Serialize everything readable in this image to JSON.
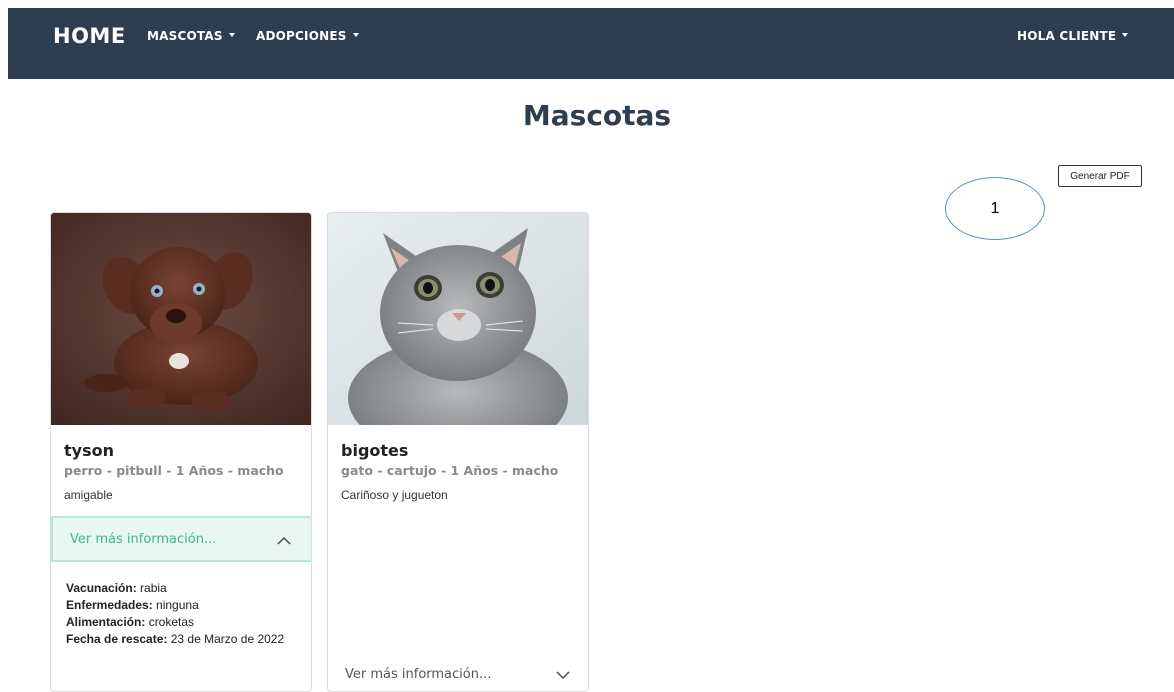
{
  "navbar": {
    "brand": "HOME",
    "menu": [
      {
        "label": "MASCOTAS"
      },
      {
        "label": "ADOPCIONES"
      }
    ],
    "user_menu": "HOLA CLIENTE"
  },
  "page": {
    "title": "Mascotas",
    "pdf_button": "Generar PDF",
    "callout": "1"
  },
  "pets": [
    {
      "name": "tyson",
      "subtitle": "perro - pitbull - 1 Años - macho",
      "description": "amigable",
      "more_label": "Ver más información...",
      "expanded": true,
      "details": [
        {
          "label": "Vacunación:",
          "value": "rabia"
        },
        {
          "label": "Enfermedades:",
          "value": "ninguna"
        },
        {
          "label": "Alimentación:",
          "value": "croketas"
        },
        {
          "label": "Fecha de rescate:",
          "value": "23 de Marzo de 2022"
        }
      ]
    },
    {
      "name": "bigotes",
      "subtitle": "gato - cartujo - 1 Años - macho",
      "description": "Cariñoso y jugueton",
      "more_label": "Ver más información...",
      "expanded": false
    }
  ],
  "colors": {
    "navbar_bg": "#2c3e50",
    "accent_teal": "#3ab795",
    "callout_stroke": "#5b8fc9"
  }
}
